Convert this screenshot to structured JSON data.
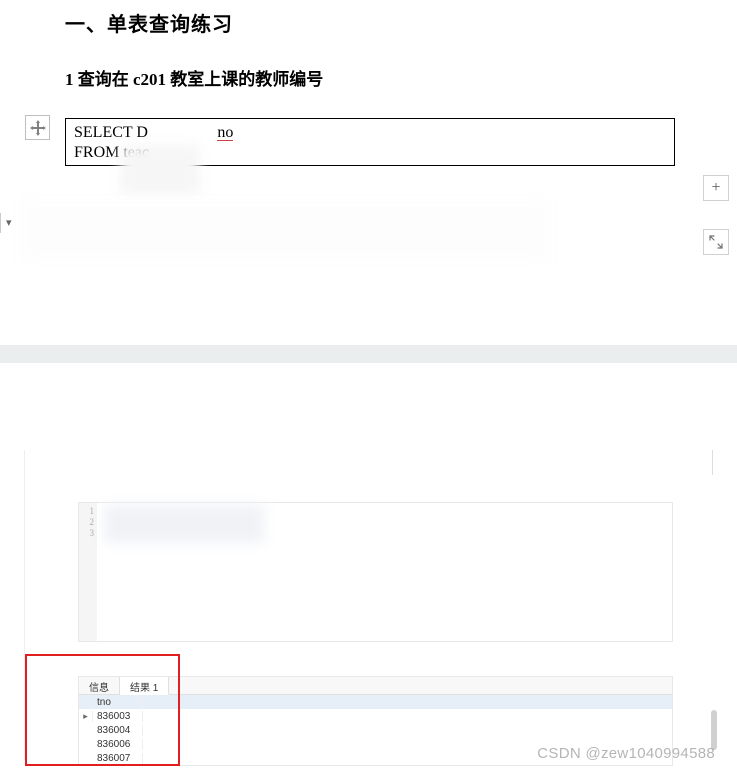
{
  "doc": {
    "section_title": "一、单表查询练习",
    "question_num": "1",
    "question_text": "查询在 c201 教室上课的教师编号",
    "code_line1_a": "SELECT D",
    "code_line1_b": "no",
    "code_line2": "FROM teac"
  },
  "toolbar": {
    "plus": "+"
  },
  "editor": {
    "line_numbers": [
      "1",
      "2",
      "3"
    ]
  },
  "result": {
    "tabs": {
      "info": "信息",
      "result": "结果 1"
    },
    "header": "tno",
    "rows": [
      "836003",
      "836004",
      "836006",
      "836007"
    ]
  },
  "watermark": "CSDN @zew1040994588"
}
